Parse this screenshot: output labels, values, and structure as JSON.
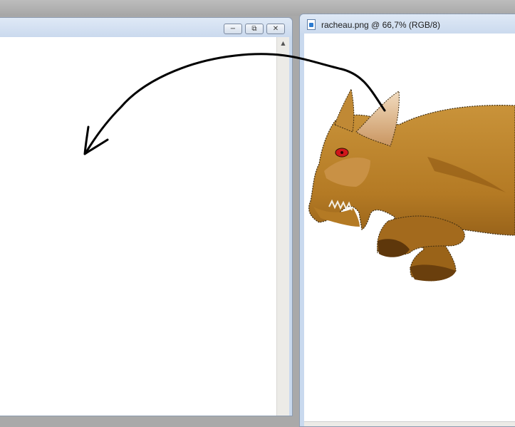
{
  "workspace": {
    "background": "#a9a9a9"
  },
  "left_window": {
    "buttons": {
      "minimize_glyph": "−",
      "restore_glyph": "⧉",
      "close_glyph": "✕"
    },
    "scroll_up_glyph": "▲"
  },
  "right_window": {
    "title": "racheau.png @ 66,7% (RGB/8)",
    "icon": "document-icon"
  },
  "colors": {
    "window_frame": "#c9d9ee",
    "creature_body": "#b9822a",
    "creature_shadow": "#7a4b12",
    "eye": "#d0161b",
    "arrow": "#000000"
  }
}
